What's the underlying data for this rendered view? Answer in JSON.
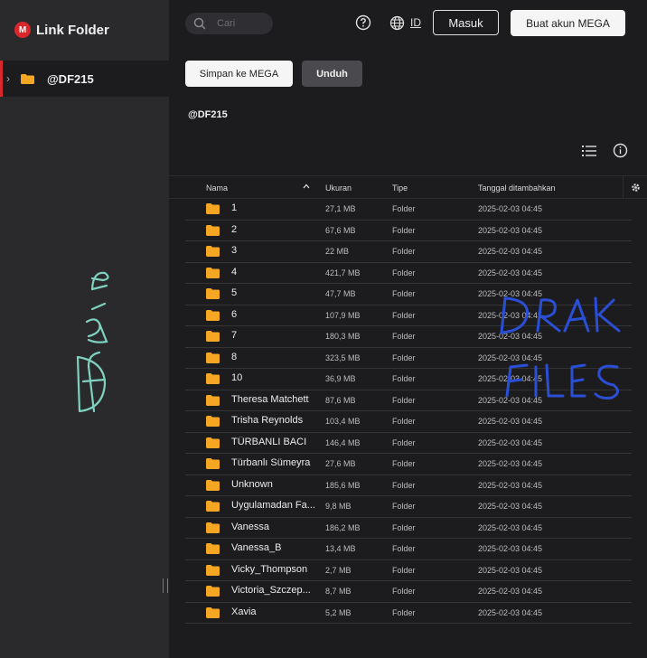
{
  "brand": {
    "logo_letter": "M",
    "name": "Link Folder",
    "accent": "#d9272e"
  },
  "sidebar": {
    "tree_item_label": "@DF215"
  },
  "header": {
    "search_placeholder": "Cari",
    "language": "ID",
    "login_label": "Masuk",
    "signup_label": "Buat akun MEGA"
  },
  "actions": {
    "save_label": "Simpan ke MEGA",
    "download_label": "Unduh"
  },
  "folder": {
    "title": "@DF215"
  },
  "table": {
    "columns": {
      "name": "Nama",
      "size": "Ukuran",
      "type": "Tipe",
      "date": "Tanggal ditambahkan"
    },
    "rows": [
      {
        "name": "1",
        "size": "27,1 MB",
        "type": "Folder",
        "date": "2025-02-03 04:45"
      },
      {
        "name": "2",
        "size": "67,6 MB",
        "type": "Folder",
        "date": "2025-02-03 04:45"
      },
      {
        "name": "3",
        "size": "22 MB",
        "type": "Folder",
        "date": "2025-02-03 04:45"
      },
      {
        "name": "4",
        "size": "421,7 MB",
        "type": "Folder",
        "date": "2025-02-03 04:45"
      },
      {
        "name": "5",
        "size": "47,7 MB",
        "type": "Folder",
        "date": "2025-02-03 04:45"
      },
      {
        "name": "6",
        "size": "107,9 MB",
        "type": "Folder",
        "date": "2025-02-03 04:45"
      },
      {
        "name": "7",
        "size": "180,3 MB",
        "type": "Folder",
        "date": "2025-02-03 04:45"
      },
      {
        "name": "8",
        "size": "323,5 MB",
        "type": "Folder",
        "date": "2025-02-03 04:45"
      },
      {
        "name": "10",
        "size": "36,9 MB",
        "type": "Folder",
        "date": "2025-02-03 04:45"
      },
      {
        "name": "Theresa Matchett",
        "size": "87,6 MB",
        "type": "Folder",
        "date": "2025-02-03 04:45"
      },
      {
        "name": "Trisha Reynolds",
        "size": "103,4 MB",
        "type": "Folder",
        "date": "2025-02-03 04:45"
      },
      {
        "name": "TÜRBANLI BACI",
        "size": "146,4 MB",
        "type": "Folder",
        "date": "2025-02-03 04:45"
      },
      {
        "name": "Türbanlı Sümeyra",
        "size": "27,6 MB",
        "type": "Folder",
        "date": "2025-02-03 04:45"
      },
      {
        "name": "Unknown",
        "size": "185,6 MB",
        "type": "Folder",
        "date": "2025-02-03 04:45"
      },
      {
        "name": "Uygulamadan Fa...",
        "size": "9,8 MB",
        "type": "Folder",
        "date": "2025-02-03 04:45"
      },
      {
        "name": "Vanessa",
        "size": "186,2 MB",
        "type": "Folder",
        "date": "2025-02-03 04:45"
      },
      {
        "name": "Vanessa_B",
        "size": "13,4 MB",
        "type": "Folder",
        "date": "2025-02-03 04:45"
      },
      {
        "name": "Vicky_Thompson",
        "size": "2,7 MB",
        "type": "Folder",
        "date": "2025-02-03 04:45"
      },
      {
        "name": "Victoria_Szczep...",
        "size": "8,7 MB",
        "type": "Folder",
        "date": "2025-02-03 04:45"
      },
      {
        "name": "Xavia",
        "size": "5,2 MB",
        "type": "Folder",
        "date": "2025-02-03 04:45"
      }
    ]
  },
  "annotations": {
    "handwriting_left": "DF 215",
    "handwriting_overlay": [
      "DRAK",
      "FILES"
    ]
  },
  "colors": {
    "folder": "#f5a623",
    "handwriting_left": "#7fd1c0",
    "handwriting_overlay": "#2a4fd6"
  }
}
